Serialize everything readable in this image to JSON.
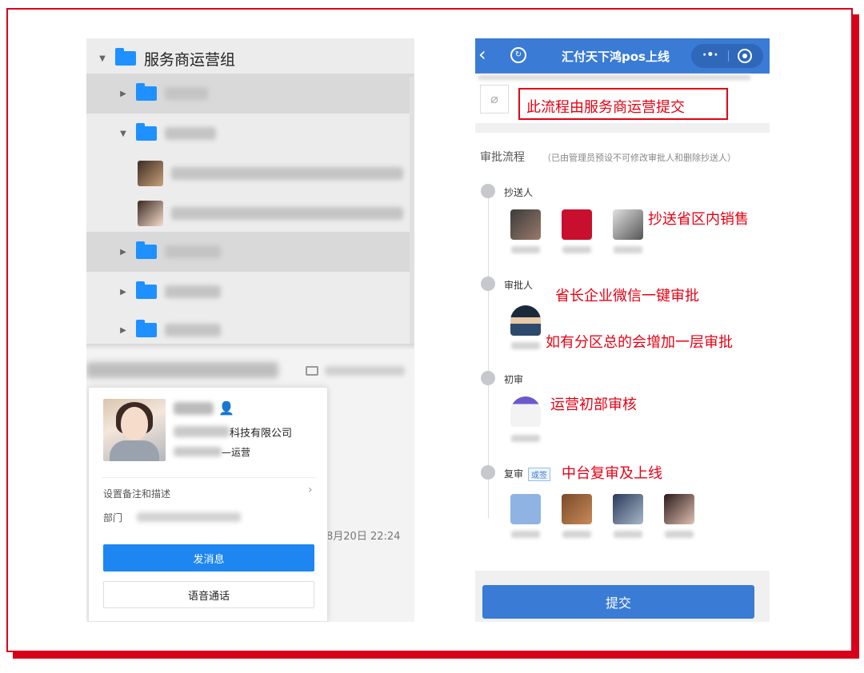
{
  "left_panel": {
    "tree": {
      "root_label": "服务商运营组"
    },
    "card": {
      "company_suffix": "科技有限公司",
      "dept_suffix": "—运营",
      "settings_label": "设置备注和描述",
      "dept_label": "部门",
      "message_button": "发消息",
      "voice_button": "语音通话"
    },
    "chat_date": "8月20日 22:24"
  },
  "right_panel": {
    "topbar": {
      "back_glyph": "‹",
      "title": "汇付天下鸿pos上线",
      "dots": "·•·"
    },
    "attachment": {
      "clip_glyph": "⌀"
    },
    "red_note": "此流程由服务商运营提交",
    "flow": {
      "title": "审批流程",
      "note": "（已由管理员预设不可修改审批人和删除抄送人）",
      "steps": [
        {
          "label": "抄送人",
          "annotation": "抄送省区内销售"
        },
        {
          "label": "审批人",
          "annotation": "省长企业微信一键审批",
          "annotation2": "如有分区总的会增加一层审批"
        },
        {
          "label": "初审",
          "annotation": "运营初部审核"
        },
        {
          "label": "复审",
          "tag": "或签",
          "annotation": "中台复审及上线"
        }
      ]
    },
    "submit_button": "提交"
  },
  "colors": {
    "accent_blue": "#3a7bd5",
    "button_blue": "#1e86f0",
    "annotation_red": "#e60012",
    "frame_red": "#d8001a",
    "folder_blue": "#1e90ff"
  }
}
